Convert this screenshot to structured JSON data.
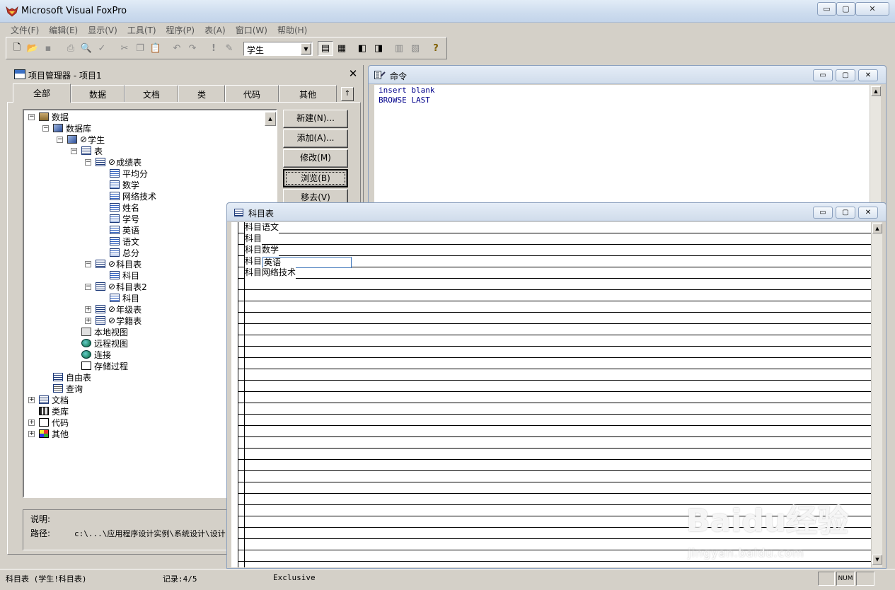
{
  "app": {
    "title": "Microsoft Visual FoxPro",
    "window_controls": {
      "minimize": "▭",
      "maximize": "▢",
      "close": "✕"
    }
  },
  "menu": [
    "文件(F)",
    "编辑(E)",
    "显示(V)",
    "工具(T)",
    "程序(P)",
    "表(A)",
    "窗口(W)",
    "帮助(H)"
  ],
  "toolbar": {
    "icons": [
      "new-icon",
      "open-icon",
      "save-icon",
      "print-icon",
      "print-preview-icon",
      "spell-check-icon",
      "cut-icon",
      "copy-icon",
      "paste-icon",
      "undo-icon",
      "redo-icon",
      "run-icon",
      "modify-form-icon",
      "command-window-icon",
      "data-session-icon",
      "form-wizard-icon",
      "report-wizard-icon",
      "autoform-icon",
      "autoreport-icon",
      "help-icon"
    ],
    "database_combo": "学生"
  },
  "project_manager": {
    "title": "项目管理器 - 项目1",
    "close": "✕",
    "tabs": [
      "全部",
      "数据",
      "文档",
      "类",
      "代码",
      "其他"
    ],
    "tab_scroll": "↑",
    "tree": [
      {
        "label": "数据",
        "expander": "⊟",
        "icon": "data-icon"
      },
      {
        "label": "数据库",
        "expander": "⊟",
        "icon": "database-icon"
      },
      {
        "label": "学生",
        "expander": "⊟",
        "icon": "database-icon",
        "excluded_mark": "⊘"
      },
      {
        "label": "表",
        "expander": "⊟",
        "icon": "table-icon"
      },
      {
        "label": "成绩表",
        "expander": "⊟",
        "icon": "table-icon",
        "excluded_mark": "⊘"
      },
      {
        "label": "平均分",
        "icon": "field-icon"
      },
      {
        "label": "数学",
        "icon": "field-icon"
      },
      {
        "label": "网络技术",
        "icon": "field-icon"
      },
      {
        "label": "姓名",
        "icon": "field-icon"
      },
      {
        "label": "学号",
        "icon": "field-icon"
      },
      {
        "label": "英语",
        "icon": "field-icon"
      },
      {
        "label": "语文",
        "icon": "field-icon"
      },
      {
        "label": "总分",
        "icon": "field-icon"
      },
      {
        "label": "科目表",
        "expander": "⊟",
        "icon": "table-icon",
        "excluded_mark": "⊘"
      },
      {
        "label": "科目",
        "icon": "field-icon"
      },
      {
        "label": "科目表2",
        "expander": "⊟",
        "icon": "table-icon",
        "excluded_mark": "⊘"
      },
      {
        "label": "科目",
        "icon": "field-icon"
      },
      {
        "label": "年级表",
        "expander": "⊞",
        "icon": "table-icon",
        "excluded_mark": "⊘"
      },
      {
        "label": "学籍表",
        "expander": "⊞",
        "icon": "table-icon",
        "excluded_mark": "⊘"
      },
      {
        "label": "本地视图",
        "icon": "local-view-icon"
      },
      {
        "label": "远程视图",
        "icon": "remote-view-icon"
      },
      {
        "label": "连接",
        "icon": "connection-icon"
      },
      {
        "label": "存储过程",
        "icon": "stored-procedure-icon"
      },
      {
        "label": "自由表",
        "icon": "table-icon"
      },
      {
        "label": "查询",
        "icon": "query-icon"
      },
      {
        "label": "文档",
        "expander": "⊞",
        "icon": "document-icon"
      },
      {
        "label": "类库",
        "icon": "class-library-icon"
      },
      {
        "label": "代码",
        "expander": "⊞",
        "icon": "code-icon"
      },
      {
        "label": "其他",
        "expander": "⊞",
        "icon": "other-icon"
      }
    ],
    "buttons": [
      "新建(N)...",
      "添加(A)...",
      "修改(M)",
      "浏览(B)",
      "移去(V)"
    ],
    "info": {
      "description_label": "说明:",
      "path_label": "路径:",
      "path_value": "c:\\...\\应用程序设计实例\\系统设计\\设计"
    }
  },
  "command_window": {
    "title": "命令",
    "lines": [
      "insert blank",
      "BROWSE LAST"
    ],
    "controls": {
      "minimize": "▭",
      "maximize": "▢",
      "close": "✕"
    }
  },
  "browse_window": {
    "title": "科目表",
    "rows": [
      "科目语文",
      "科目",
      "科目数学",
      "科目",
      "科目网络技术"
    ],
    "edit_cell_value": "英语",
    "controls": {
      "minimize": "▭",
      "maximize": "▢",
      "close": "✕"
    }
  },
  "status_bar": {
    "table": "科目表 (学生!科目表)",
    "record": "记录:4/5",
    "mode": "Exclusive",
    "num": "NUM"
  },
  "watermark": {
    "text": "Baidu经验",
    "sub": "jingyan.baidu.com"
  }
}
